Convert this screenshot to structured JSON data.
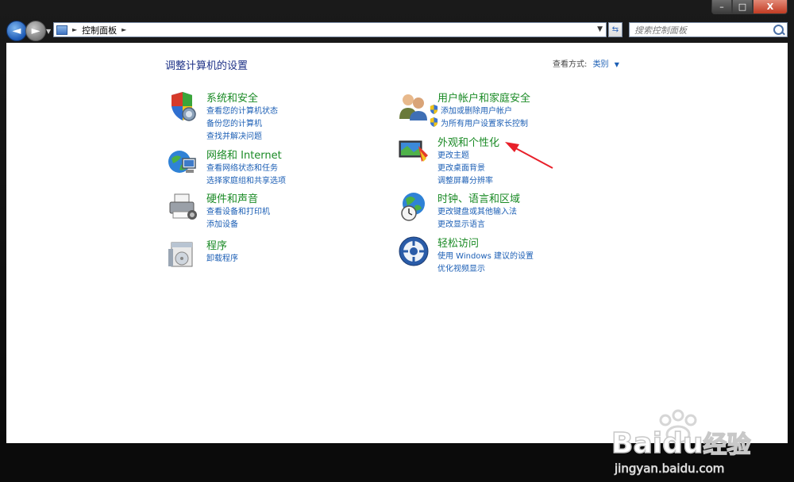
{
  "window": {
    "minimize_label": "–",
    "maximize_label": "□",
    "close_label": "X"
  },
  "navigation": {
    "back_label": "◄",
    "forward_label": "►",
    "address_segments": [
      "控制面板"
    ],
    "search_placeholder": "搜索控制面板"
  },
  "page": {
    "title": "调整计算机的设置",
    "view_by_label": "查看方式:",
    "view_by_value": "类别"
  },
  "categories": [
    {
      "title": "系统和安全",
      "icon": "system-security-icon",
      "links": [
        "查看您的计算机状态",
        "备份您的计算机",
        "查找并解决问题"
      ]
    },
    {
      "title": "网络和 Internet",
      "icon": "network-internet-icon",
      "links": [
        "查看网络状态和任务",
        "选择家庭组和共享选项"
      ]
    },
    {
      "title": "硬件和声音",
      "icon": "hardware-sound-icon",
      "links": [
        "查看设备和打印机",
        "添加设备"
      ]
    },
    {
      "title": "程序",
      "icon": "programs-icon",
      "links": [
        "卸载程序"
      ]
    },
    {
      "title": "用户帐户和家庭安全",
      "icon": "user-accounts-icon",
      "links": [
        "添加或删除用户帐户",
        "为所有用户设置家长控制"
      ]
    },
    {
      "title": "外观和个性化",
      "icon": "appearance-icon",
      "links": [
        "更改主题",
        "更改桌面背景",
        "调整屏幕分辨率"
      ]
    },
    {
      "title": "时钟、语言和区域",
      "icon": "clock-language-icon",
      "links": [
        "更改键盘或其他输入法",
        "更改显示语言"
      ]
    },
    {
      "title": "轻松访问",
      "icon": "ease-of-access-icon",
      "links": [
        "使用 Windows 建议的设置",
        "优化视频显示"
      ]
    }
  ],
  "watermark": {
    "brand": "Bai",
    "brand2": "du",
    "brand_cn": "经验",
    "url": "jingyan.baidu.com"
  },
  "colors": {
    "category_title": "#1a8a25",
    "link": "#1c5fb5",
    "page_title": "#1e3287",
    "annotation_arrow": "#e8202a"
  }
}
